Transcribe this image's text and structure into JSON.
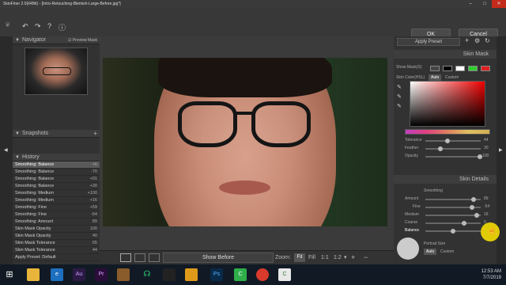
{
  "window": {
    "title": "SkinFiner 2.0(64Bit) - [Intro-Retouching-Blemish-Large-Before.jpg*]"
  },
  "toolbar": {
    "ok_label": "OK",
    "cancel_label": "Cancel"
  },
  "navigator": {
    "title": "Navigator",
    "preview_mask_label": "Preview Mask"
  },
  "snapshots": {
    "title": "Snapshots"
  },
  "history": {
    "title": "History",
    "items": [
      {
        "label": "Smoothing: Balance",
        "value": "+6"
      },
      {
        "label": "Smoothing: Balance",
        "value": "-70"
      },
      {
        "label": "Smoothing: Balance",
        "value": "+91"
      },
      {
        "label": "Smoothing: Balance",
        "value": "+30"
      },
      {
        "label": "Smoothing: Medium",
        "value": "+100"
      },
      {
        "label": "Smoothing: Medium",
        "value": "+16"
      },
      {
        "label": "Smoothing: Fine",
        "value": "+59"
      },
      {
        "label": "Smoothing: Fine",
        "value": "-54"
      },
      {
        "label": "Smoothing: Amount",
        "value": "89"
      },
      {
        "label": "Skin Mask Opacity",
        "value": "100"
      },
      {
        "label": "Skin Mask Opacity",
        "value": "40"
      },
      {
        "label": "Skin Mask Tolerance",
        "value": "65"
      },
      {
        "label": "Skin Mask Tolerance",
        "value": "44"
      },
      {
        "label": "Apply Preset: Default",
        "value": ""
      }
    ]
  },
  "bottombar": {
    "show_before": "Show Before",
    "zoom_label": "Zoom:",
    "zoom_fit": "Fit",
    "zoom_fill": "Fill",
    "zoom_1_1": "1:1",
    "zoom_1_2": "1:2"
  },
  "right": {
    "apply_preset": "Apply Preset",
    "skin_mask_title": "Skin Mask",
    "show_mask_label": "Show Mask(S)",
    "skin_color_label": "Skin Color(HSL)",
    "auto_label": "Auto",
    "custom_label": "Custom",
    "tolerance_label": "Tolerance",
    "tolerance_value": "44",
    "feather_label": "Feather",
    "feather_value": "30",
    "opacity_label": "Opacity",
    "opacity_value": "100",
    "skin_details_title": "Skin Details",
    "smoothing_label": "Smoothing",
    "amount_label": "Amount",
    "amount_value": "89",
    "fine_label": "Fine",
    "fine_value": "-54",
    "medium_label": "Medium",
    "medium_value": "16",
    "coarse_label": "Coarse",
    "coarse_value": "0",
    "balance_label": "Balance",
    "portrait_size_label": "Portrait Size",
    "portrait_auto": "Auto",
    "portrait_custom": "Custom"
  },
  "taskbar": {
    "time": "12:53 AM",
    "date": "7/7/2019"
  },
  "colors": {
    "accent": "#5a5a5a",
    "panel": "#323232",
    "cursor": "#ffe600"
  }
}
